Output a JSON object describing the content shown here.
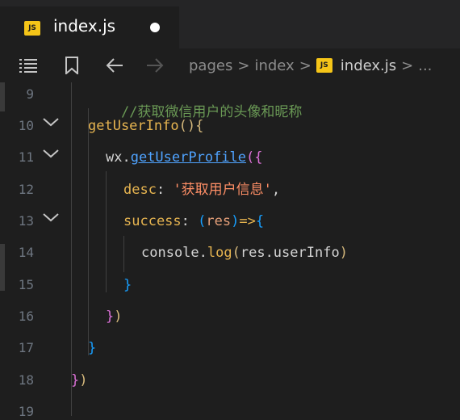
{
  "tab": {
    "badge": "JS",
    "title": "index.js"
  },
  "breadcrumb": {
    "segments": [
      "pages",
      "index"
    ],
    "file_badge": "JS",
    "file": "index.js",
    "separator": ">",
    "ellipsis": "..."
  },
  "gutter": {
    "line_numbers": [
      "9",
      "10",
      "11",
      "12",
      "13",
      "14",
      "15",
      "16",
      "17",
      "18",
      "19"
    ]
  },
  "code": {
    "l9": "//获取微信用户的头像和昵称",
    "l10_fn": "getUserInfo",
    "l10_paren": "()",
    "l10_brace": "{",
    "l11_obj": "wx.",
    "l11_method": "getUserProfile",
    "l11_open": "(",
    "l11_brace": "{",
    "l12_key": "desc",
    "l12_colon": ": ",
    "l12_str": "'获取用户信息'",
    "l12_comma": ",",
    "l13_key": "success",
    "l13_colon": ": ",
    "l13_popen": "(",
    "l13_param": "res",
    "l13_pclose": ")",
    "l13_arrow": "=>",
    "l13_brace": "{",
    "l14_obj": "console.",
    "l14_method": "log",
    "l14_open": "(",
    "l14_arg": "res.userInfo",
    "l14_close": ")",
    "l15": "}",
    "l16_brace": "}",
    "l16_paren": ")",
    "l17": "}",
    "l18_brace": "}",
    "l18_paren": ")"
  }
}
